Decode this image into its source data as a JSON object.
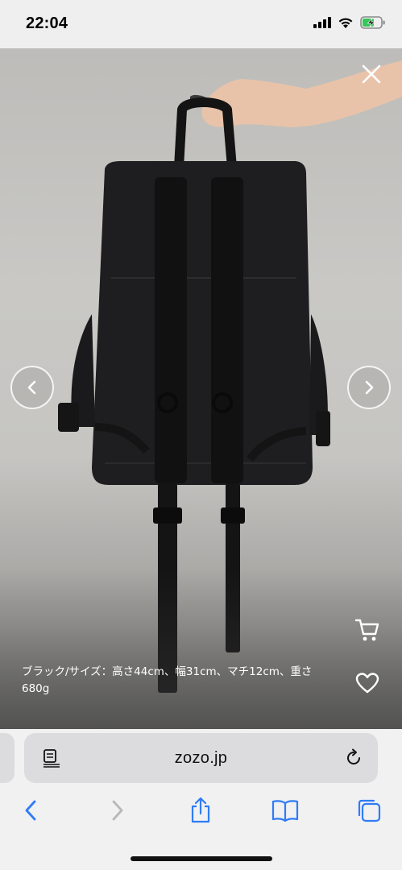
{
  "status_bar": {
    "time": "22:04",
    "signal_icon": "cellular-signal-icon",
    "wifi_icon": "wifi-icon",
    "battery_icon": "battery-charging-icon"
  },
  "viewer": {
    "close_icon": "close-icon",
    "prev_icon": "chevron-left-icon",
    "next_icon": "chevron-right-icon",
    "cart_icon": "cart-icon",
    "favorite_icon": "heart-icon",
    "caption": "ブラック/サイズ：高さ44cm、幅31cm、マチ12cm、重さ680g"
  },
  "browser": {
    "url": "zozo.jp",
    "reader_icon": "reader-mode-icon",
    "reload_icon": "reload-icon",
    "toolbar": {
      "back_icon": "back-icon",
      "forward_icon": "forward-icon",
      "share_icon": "share-icon",
      "bookmarks_icon": "bookmarks-icon",
      "tabs_icon": "tabs-icon"
    },
    "accent_color": "#2f7cf6"
  }
}
